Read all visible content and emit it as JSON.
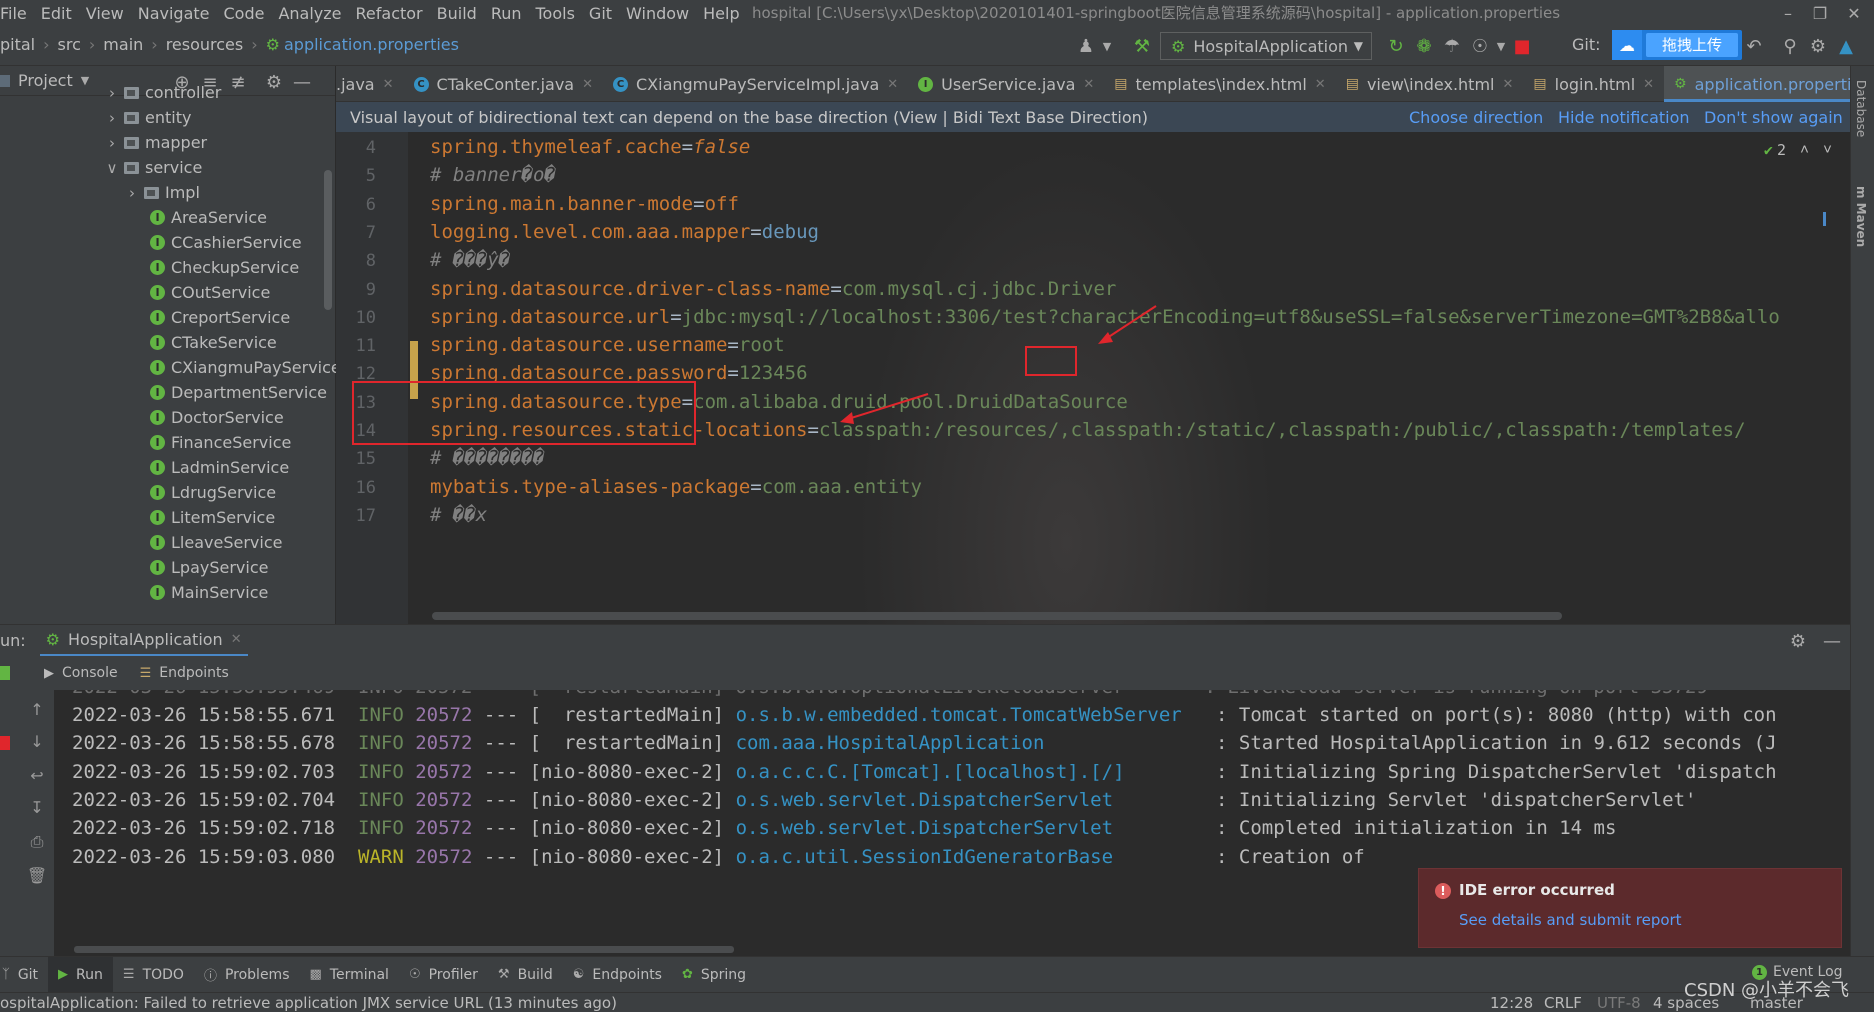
{
  "menubar": {
    "items": [
      "File",
      "Edit",
      "View",
      "Navigate",
      "Code",
      "Analyze",
      "Refactor",
      "Build",
      "Run",
      "Tools",
      "Git",
      "Window",
      "Help"
    ],
    "window_title": "hospital [C:\\Users\\yx\\Desktop\\2020101401-springboot医院信息管理系统源码\\hospital] - application.properties"
  },
  "navbar": {
    "crumbs": [
      "pital",
      "src",
      "main",
      "resources",
      "application.properties"
    ],
    "run_config": "HospitalApplication",
    "git_label": "Git:",
    "baidu_button": "拖拽上传"
  },
  "project": {
    "title": "Project",
    "tree": [
      {
        "label": "controller",
        "type": "folder",
        "expanded": false,
        "indent": 1
      },
      {
        "label": "entity",
        "type": "folder",
        "expanded": false,
        "indent": 1
      },
      {
        "label": "mapper",
        "type": "folder",
        "expanded": false,
        "indent": 1
      },
      {
        "label": "service",
        "type": "folder",
        "expanded": true,
        "indent": 1
      },
      {
        "label": "Impl",
        "type": "folder",
        "expanded": false,
        "indent": 2
      },
      {
        "label": "AreaService",
        "type": "interface",
        "indent": 3
      },
      {
        "label": "CCashierService",
        "type": "interface",
        "indent": 3
      },
      {
        "label": "CheckupService",
        "type": "interface",
        "indent": 3
      },
      {
        "label": "COutService",
        "type": "interface",
        "indent": 3
      },
      {
        "label": "CreportService",
        "type": "interface",
        "indent": 3
      },
      {
        "label": "CTakeService",
        "type": "interface",
        "indent": 3
      },
      {
        "label": "CXiangmuPayService",
        "type": "interface",
        "indent": 3
      },
      {
        "label": "DepartmentService",
        "type": "interface",
        "indent": 3
      },
      {
        "label": "DoctorService",
        "type": "interface",
        "indent": 3
      },
      {
        "label": "FinanceService",
        "type": "interface",
        "indent": 3
      },
      {
        "label": "LadminService",
        "type": "interface",
        "indent": 3
      },
      {
        "label": "LdrugService",
        "type": "interface",
        "indent": 3
      },
      {
        "label": "LitemService",
        "type": "interface",
        "indent": 3
      },
      {
        "label": "LleaveService",
        "type": "interface",
        "indent": 3
      },
      {
        "label": "LpayService",
        "type": "interface",
        "indent": 3
      },
      {
        "label": "MainService",
        "type": "interface",
        "indent": 3
      }
    ]
  },
  "tabs": [
    {
      "label": ".java",
      "icon": "none",
      "active": false
    },
    {
      "label": "CTakeConter.java",
      "icon": "class",
      "active": false
    },
    {
      "label": "CXiangmuPayServiceImpl.java",
      "icon": "class",
      "active": false
    },
    {
      "label": "UserService.java",
      "icon": "interface",
      "active": false
    },
    {
      "label": "templates\\index.html",
      "icon": "html",
      "active": false
    },
    {
      "label": "view\\index.html",
      "icon": "html",
      "active": false
    },
    {
      "label": "login.html",
      "icon": "html",
      "active": false
    },
    {
      "label": "application.properties",
      "icon": "properties",
      "active": true
    }
  ],
  "notification": {
    "message": "Visual layout of bidirectional text can depend on the base direction (View | Bidi Text Base Direction)",
    "actions": [
      "Choose direction",
      "Hide notification",
      "Don't show again"
    ]
  },
  "editor": {
    "inspection_count": "2",
    "lines": [
      {
        "n": "4",
        "key": "spring.thymeleaf.cache",
        "val": "false",
        "kind": "bool"
      },
      {
        "n": "5",
        "comment": "# banner�օ�"
      },
      {
        "n": "6",
        "key": "spring.main.banner-mode",
        "val": "off",
        "kind": "kw"
      },
      {
        "n": "7",
        "key": "logging.level.com.aaa.mapper",
        "val": "debug",
        "kind": "num"
      },
      {
        "n": "8",
        "comment": "# ���ŷ�"
      },
      {
        "n": "9",
        "key": "spring.datasource.driver-class-name",
        "val": "com.mysql.cj.jdbc.Driver",
        "kind": "str"
      },
      {
        "n": "10",
        "key": "spring.datasource.url",
        "val": "jdbc:mysql://localhost:3306/test?characterEncoding=utf8&useSSL=false&serverTimezone=GMT%2B8&allo",
        "kind": "str"
      },
      {
        "n": "11",
        "key": "spring.datasource.username",
        "val": "root",
        "kind": "str"
      },
      {
        "n": "12",
        "key": "spring.datasource.password",
        "val": "123456",
        "kind": "str"
      },
      {
        "n": "13",
        "key": "spring.datasource.type",
        "val": "com.alibaba.druid.pool.DruidDataSource",
        "kind": "str"
      },
      {
        "n": "14",
        "key": "spring.resources.static-locations",
        "val": "classpath:/resources/,classpath:/static/,classpath:/public/,classpath:/templates/",
        "kind": "str"
      },
      {
        "n": "15",
        "comment": "# ��������"
      },
      {
        "n": "16",
        "key": "mybatis.type-aliases-package",
        "val": "com.aaa.entity",
        "kind": "str"
      },
      {
        "n": "17",
        "comment": "# ��x"
      }
    ]
  },
  "run": {
    "label": "un:",
    "tab": "HospitalApplication",
    "subtabs": [
      "Console",
      "Endpoints"
    ],
    "log": [
      {
        "ts": "2022-03-26 15:58:55.671",
        "level": "INFO",
        "pid": "20572",
        "thread": "[  restartedMain]",
        "logger": "o.s.b.w.embedded.tomcat.TomcatWebServer",
        "msg": ": Tomcat started on port(s): 8080 (http) with con"
      },
      {
        "ts": "2022-03-26 15:58:55.678",
        "level": "INFO",
        "pid": "20572",
        "thread": "[  restartedMain]",
        "logger": "com.aaa.HospitalApplication",
        "msg": ": Started HospitalApplication in 9.612 seconds (J"
      },
      {
        "ts": "2022-03-26 15:59:02.703",
        "level": "INFO",
        "pid": "20572",
        "thread": "[nio-8080-exec-2]",
        "logger": "o.a.c.c.C.[Tomcat].[localhost].[/]",
        "msg": ": Initializing Spring DispatcherServlet 'dispatch"
      },
      {
        "ts": "2022-03-26 15:59:02.704",
        "level": "INFO",
        "pid": "20572",
        "thread": "[nio-8080-exec-2]",
        "logger": "o.s.web.servlet.DispatcherServlet",
        "msg": ": Initializing Servlet 'dispatcherServlet'"
      },
      {
        "ts": "2022-03-26 15:59:02.718",
        "level": "INFO",
        "pid": "20572",
        "thread": "[nio-8080-exec-2]",
        "logger": "o.s.web.servlet.DispatcherServlet",
        "msg": ": Completed initialization in 14 ms"
      },
      {
        "ts": "2022-03-26 15:59:03.080",
        "level": "WARN",
        "pid": "20572",
        "thread": "[nio-8080-exec-2]",
        "logger": "o.a.c.util.SessionIdGeneratorBase",
        "msg": ": Creation of"
      }
    ],
    "ide_error": {
      "title": "IDE error occurred",
      "link": "See details and submit report"
    }
  },
  "tooltabs": [
    "Git",
    "Run",
    "TODO",
    "Problems",
    "Terminal",
    "Profiler",
    "Build",
    "Endpoints",
    "Spring"
  ],
  "eventlog": {
    "badge": "1",
    "label": "Event Log"
  },
  "statusbar": {
    "message": "ospitalApplication: Failed to retrieve application JMX service URL (13 minutes ago)",
    "position": "12:28",
    "line_sep": "CRLF",
    "encoding": "UTF-8",
    "indent": "4 spaces",
    "branch": "master"
  },
  "watermark": "CSDN @小羊不会飞",
  "colors": {
    "accent": "#4a88c7",
    "annotation_red": "#e0262c",
    "error_bg": "#5c2a2c"
  }
}
